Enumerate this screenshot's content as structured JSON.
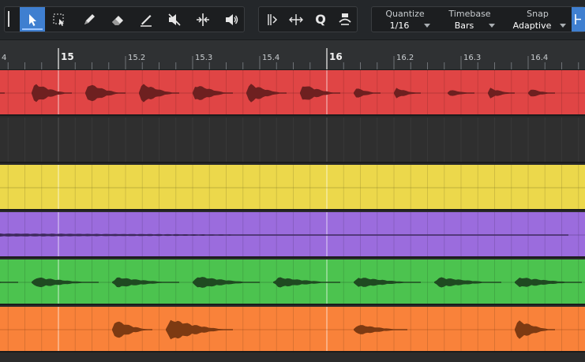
{
  "toolbar": {
    "tools": [
      {
        "name": "arrow-tool",
        "icon": "cursor-arrow-icon",
        "active": true
      },
      {
        "name": "range-tool",
        "icon": "range-select-icon",
        "active": false
      },
      {
        "name": "paint-tool",
        "icon": "pencil-icon",
        "active": false
      },
      {
        "name": "eraser-tool",
        "icon": "eraser-icon",
        "active": false
      },
      {
        "name": "draw-tool",
        "icon": "line-draw-icon",
        "active": false
      },
      {
        "name": "mute-tool",
        "icon": "mute-icon",
        "active": false
      },
      {
        "name": "split-tool",
        "icon": "split-icon",
        "active": false
      },
      {
        "name": "listen-tool",
        "icon": "speaker-icon",
        "active": false
      }
    ],
    "edit_tools": [
      {
        "name": "bend-marker-tool",
        "icon": "bend-icon"
      },
      {
        "name": "stretch-tool",
        "icon": "stretch-icon"
      },
      {
        "name": "quantize-tool",
        "icon": "q-icon",
        "glyph": "Q"
      },
      {
        "name": "loop-tool",
        "icon": "loop-icon"
      }
    ],
    "settings": {
      "quantize": {
        "label": "Quantize",
        "value": "1/16"
      },
      "timebase": {
        "label": "Timebase",
        "value": "Bars"
      },
      "snap": {
        "label": "Snap",
        "value": "Adaptive"
      }
    }
  },
  "ruler": {
    "labels": [
      {
        "pos": 14.4,
        "text": "4"
      },
      {
        "pos": 15.0,
        "text": "15"
      },
      {
        "pos": 15.2,
        "text": "15.2"
      },
      {
        "pos": 15.3,
        "text": "15.3"
      },
      {
        "pos": 15.4,
        "text": "15.4"
      },
      {
        "pos": 16.0,
        "text": "16"
      },
      {
        "pos": 16.2,
        "text": "16.2"
      },
      {
        "pos": 16.3,
        "text": "16.3"
      },
      {
        "pos": 16.4,
        "text": "16.4"
      }
    ],
    "major_bars": [
      15,
      16
    ]
  },
  "tracks": [
    {
      "name": "track-red",
      "color": "#e04545",
      "wave": "#6e2020",
      "events": [
        [
          13.95,
          14.15,
          0.7
        ],
        [
          14.2,
          14.35,
          0.6
        ],
        [
          14.45,
          14.58,
          0.5
        ],
        [
          14.65,
          14.8,
          0.6
        ],
        [
          14.9,
          15.05,
          0.55
        ],
        [
          15.1,
          15.25,
          0.55
        ],
        [
          15.3,
          15.45,
          0.55
        ],
        [
          15.5,
          15.65,
          0.5
        ],
        [
          15.7,
          15.85,
          0.55
        ],
        [
          15.9,
          16.05,
          0.5
        ],
        [
          16.1,
          16.2,
          0.3
        ],
        [
          16.25,
          16.35,
          0.3
        ],
        [
          16.45,
          16.55,
          0.2
        ],
        [
          16.6,
          16.7,
          0.3
        ],
        [
          16.75,
          16.85,
          0.25
        ],
        [
          17.4,
          17.55,
          0.55
        ],
        [
          17.6,
          17.75,
          0.6
        ]
      ]
    },
    {
      "name": "track-empty",
      "color": "#2f2f2f",
      "wave": "#2f2f2f",
      "events": []
    },
    {
      "name": "track-yellow",
      "color": "#ecd84b",
      "wave": "#6b6420",
      "events": [
        [
          17.0,
          17.6,
          0.22
        ]
      ]
    },
    {
      "name": "track-purple",
      "color": "#9b6cdd",
      "wave": "#3d2a5c",
      "events": [
        [
          13.95,
          16.9,
          0.13
        ]
      ]
    },
    {
      "name": "track-green",
      "color": "#4cc34f",
      "wave": "#1f4a21",
      "events": [
        [
          13.95,
          14.2,
          0.3
        ],
        [
          14.25,
          14.55,
          0.35
        ],
        [
          14.6,
          14.85,
          0.3
        ],
        [
          14.9,
          15.15,
          0.3
        ],
        [
          15.2,
          15.45,
          0.3
        ],
        [
          15.5,
          15.75,
          0.35
        ],
        [
          15.8,
          16.05,
          0.3
        ],
        [
          16.1,
          16.35,
          0.3
        ],
        [
          16.4,
          16.65,
          0.3
        ],
        [
          16.7,
          16.95,
          0.3
        ]
      ]
    },
    {
      "name": "track-orange",
      "color": "#f9823a",
      "wave": "#7d3a12",
      "events": [
        [
          14.35,
          14.5,
          0.55
        ],
        [
          14.55,
          14.7,
          0.3
        ],
        [
          15.2,
          15.35,
          0.55
        ],
        [
          15.4,
          15.65,
          0.6
        ],
        [
          16.1,
          16.3,
          0.3
        ],
        [
          16.7,
          16.85,
          0.55
        ]
      ]
    }
  ]
}
